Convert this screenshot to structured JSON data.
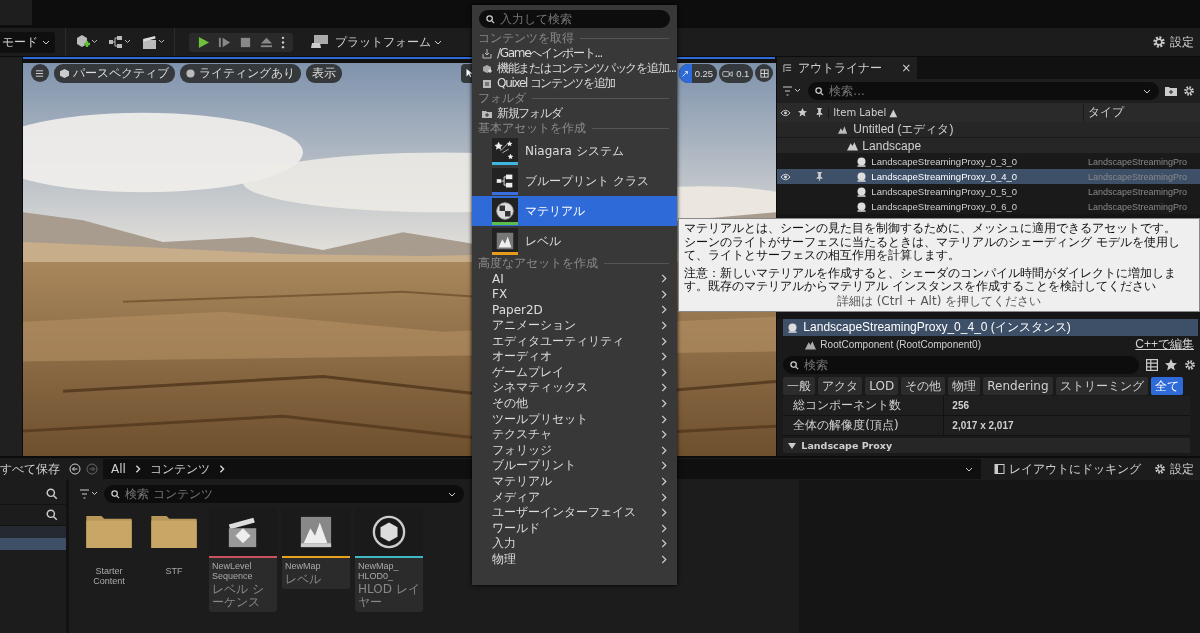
{
  "toolbar": {
    "mode": "モード",
    "platform": "プラットフォーム",
    "settings": "設定"
  },
  "viewport": {
    "view_mode": "パースペクティブ",
    "lighting": "ライティングあり",
    "show": "表示",
    "scale": "0.25",
    "camera_speed": "0.1"
  },
  "outliner": {
    "title": "アウトライナー",
    "close": "×",
    "search_placeholder": "検索...",
    "label_column": "Item Label",
    "sort_indicator": "▲",
    "type_column": "タイプ",
    "tree": [
      {
        "label": "Untitled (エディタ)",
        "kind": "world",
        "selected": false,
        "children": [
          {
            "label": "Landscape",
            "kind": "landscape",
            "selected": false,
            "children": [
              {
                "label": "LandscapeStreamingProxy_0_3_0",
                "type": "LandscapeStreamingPro",
                "kind": "proxy",
                "selected": false
              },
              {
                "label": "LandscapeStreamingProxy_0_4_0",
                "type": "LandscapeStreamingPro",
                "kind": "proxy",
                "selected": true
              },
              {
                "label": "LandscapeStreamingProxy_0_5_0",
                "type": "LandscapeStreamingPro",
                "kind": "proxy",
                "selected": false
              },
              {
                "label": "LandscapeStreamingProxy_0_6_0",
                "type": "LandscapeStreamingPro",
                "kind": "proxy",
                "selected": false
              }
            ]
          }
        ]
      }
    ]
  },
  "details": {
    "actor": "LandscapeStreamingProxy_0_4_0 (インスタンス)",
    "actor_selected": true,
    "component": "RootComponent (RootComponent0)",
    "edit_link": "C++で編集",
    "search_placeholder": "検索",
    "filters": [
      {
        "label": "一般",
        "selected": false
      },
      {
        "label": "アクタ",
        "selected": false
      },
      {
        "label": "LOD",
        "selected": false
      },
      {
        "label": "その他",
        "selected": false
      },
      {
        "label": "物理",
        "selected": false
      },
      {
        "label": "Rendering",
        "selected": false
      },
      {
        "label": "ストリーミング",
        "selected": false
      },
      {
        "label": "全て",
        "selected": true
      }
    ],
    "properties": [
      {
        "name": "総コンポーネント数",
        "value": "256"
      },
      {
        "name": "全体の解像度(頂点)",
        "value": "2,017 x 2,017"
      }
    ],
    "section": "Landscape Proxy"
  },
  "add_menu": {
    "search_placeholder": "入力して検索",
    "sections": [
      {
        "title": "コンテンツを取得",
        "kind": "actions",
        "items": [
          {
            "label": "/Gameへインポート...",
            "kind": "import"
          },
          {
            "label": "機能またはコンテンツパックを追加...",
            "kind": "pack"
          },
          {
            "label": "Quixel コンテンツを追加",
            "kind": "quixel"
          }
        ]
      },
      {
        "title": "フォルダ",
        "kind": "actions",
        "items": [
          {
            "label": "新規フォルダ",
            "kind": "folder"
          }
        ]
      },
      {
        "title": "基本アセットを作成",
        "kind": "assets",
        "items": [
          {
            "label": "Niagara システム",
            "kind": "niagara",
            "color": "#3fb6e0",
            "selected": false
          },
          {
            "label": "ブループリント クラス",
            "kind": "blueprint",
            "color": "#3a6fe0",
            "selected": false
          },
          {
            "label": "マテリアル",
            "kind": "material",
            "color": "#5bbd4a",
            "selected": true
          },
          {
            "label": "レベル",
            "kind": "level",
            "color": "#e89a1c",
            "selected": false
          }
        ]
      },
      {
        "title": "高度なアセットを作成",
        "kind": "categories",
        "items": [
          {
            "label": "AI"
          },
          {
            "label": "FX"
          },
          {
            "label": "Paper2D"
          },
          {
            "label": "アニメーション"
          },
          {
            "label": "エディタユーティリティ"
          },
          {
            "label": "オーディオ"
          },
          {
            "label": "ゲームプレイ"
          },
          {
            "label": "シネマティックス"
          },
          {
            "label": "その他"
          },
          {
            "label": "ツールプリセット"
          },
          {
            "label": "テクスチャ"
          },
          {
            "label": "フォリッジ"
          },
          {
            "label": "ブループリント"
          },
          {
            "label": "マテリアル"
          },
          {
            "label": "メディア"
          },
          {
            "label": "ユーザーインターフェイス"
          },
          {
            "label": "ワールド"
          },
          {
            "label": "入力"
          },
          {
            "label": "物理"
          }
        ]
      }
    ]
  },
  "tooltip": {
    "lines": [
      "マテリアルとは、シーンの見た目を制御するために、メッシュに適用できるアセットです。",
      "シーンのライトがサーフェスに当たるときは、マテリアルのシェーディング モデルを使用して、ライトとサーフェスの相互作用を計算します。"
    ],
    "note": "注意：新しいマテリアルを作成すると、シェーダのコンパイル時間がダイレクトに増加します。既存のマテリアルからマテリアル インスタンスを作成することを検討してください",
    "hint": "詳細は (Ctrl + Alt) を押してください"
  },
  "content_browser": {
    "save_all": "すべて保存",
    "breadcrumb": [
      "All",
      "コンテンツ"
    ],
    "dock": "レイアウトにドッキング",
    "settings": "設定",
    "search_placeholder": "検索 コンテンツ",
    "items": [
      {
        "kind": "folder",
        "name": "Starter Content"
      },
      {
        "kind": "folder",
        "name": "STF"
      },
      {
        "kind": "sequence",
        "name": "NewLevel Sequence",
        "type": "レベル シーケンス",
        "color": "#c9525c"
      },
      {
        "kind": "map",
        "name": "NewMap",
        "type": "レベル",
        "color": "#e8a21e"
      },
      {
        "kind": "hlod",
        "name": "NewMap_ HLOD0_",
        "type": "HLOD レイヤー",
        "color": "#3fb8c4"
      }
    ]
  }
}
